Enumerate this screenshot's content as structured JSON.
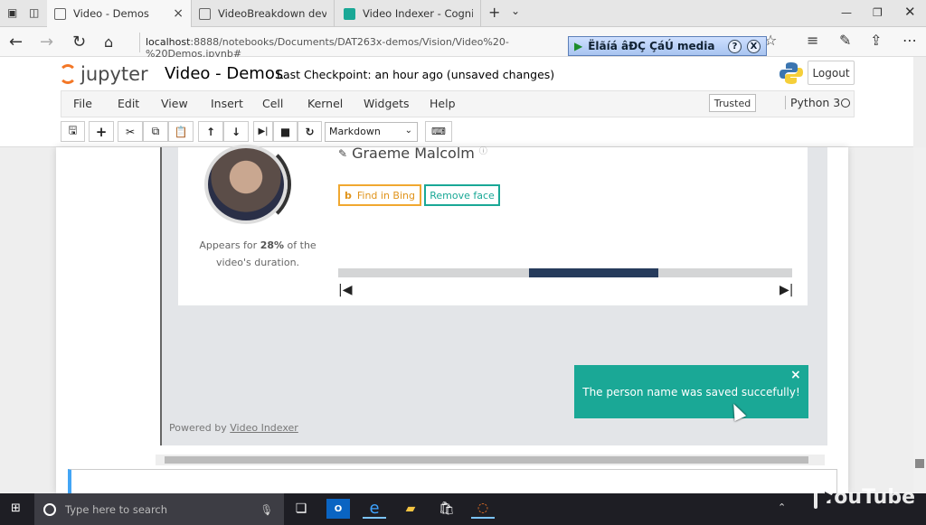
{
  "browser": {
    "tabs": [
      {
        "title": "Video - Demos",
        "active": true
      },
      {
        "title": "VideoBreakdown developer",
        "active": false
      },
      {
        "title": "Video Indexer - Cognitive V",
        "active": false
      }
    ],
    "url_host": "localhost",
    "url_path": ":8888/notebooks/Documents/DAT263x-demos/Vision/Video%20-%20Demos.ipynb#",
    "extension_text": "Ëlãíá âÐÇ ÇáÚ media",
    "extension_help": "?",
    "extension_close": "X"
  },
  "jupyter": {
    "logo_text": "jupyter",
    "notebook_title": "Video - Demos",
    "checkpoint": "Last Checkpoint: an hour ago (unsaved changes)",
    "logout_label": "Logout",
    "menu": [
      "File",
      "Edit",
      "View",
      "Insert",
      "Cell",
      "Kernel",
      "Widgets",
      "Help"
    ],
    "trusted_label": "Trusted",
    "kernel_name": "Python 3",
    "cell_type": "Markdown"
  },
  "widget": {
    "person_name": "Graeme Malcolm",
    "appears_pre": "Appears for ",
    "appears_pct": "28%",
    "appears_post": " of the video's duration.",
    "find_bing_label": "Find in Bing",
    "remove_face_label": "Remove face",
    "timeline_segment": {
      "start": 0.42,
      "end": 0.705
    },
    "toast_message": "The person name was saved succefully!",
    "toast_close": "×",
    "powered_by_prefix": "Powered by ",
    "powered_by_link": "Video Indexer"
  },
  "taskbar": {
    "search_placeholder": "Type here to search",
    "watermark": "YouTube"
  },
  "colors": {
    "teal": "#1aa896",
    "bing_orange": "#f0a830",
    "timeline_segment": "#263b5c"
  }
}
